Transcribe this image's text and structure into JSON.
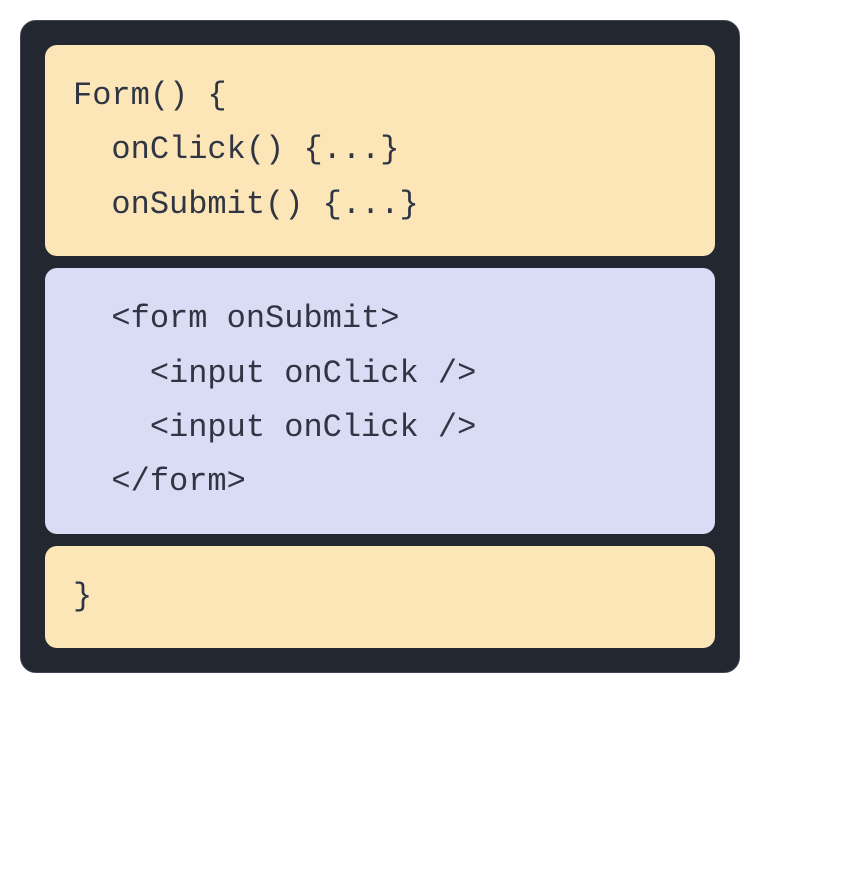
{
  "blocks": {
    "top": {
      "line1": "Form() {",
      "line2": "  onClick() {...}",
      "line3": "  onSubmit() {...}"
    },
    "middle": {
      "line1": "  <form onSubmit>",
      "line2": "    <input onClick />",
      "line3": "    <input onClick />",
      "line4": "  </form>"
    },
    "bottom": {
      "line1": "}"
    }
  }
}
